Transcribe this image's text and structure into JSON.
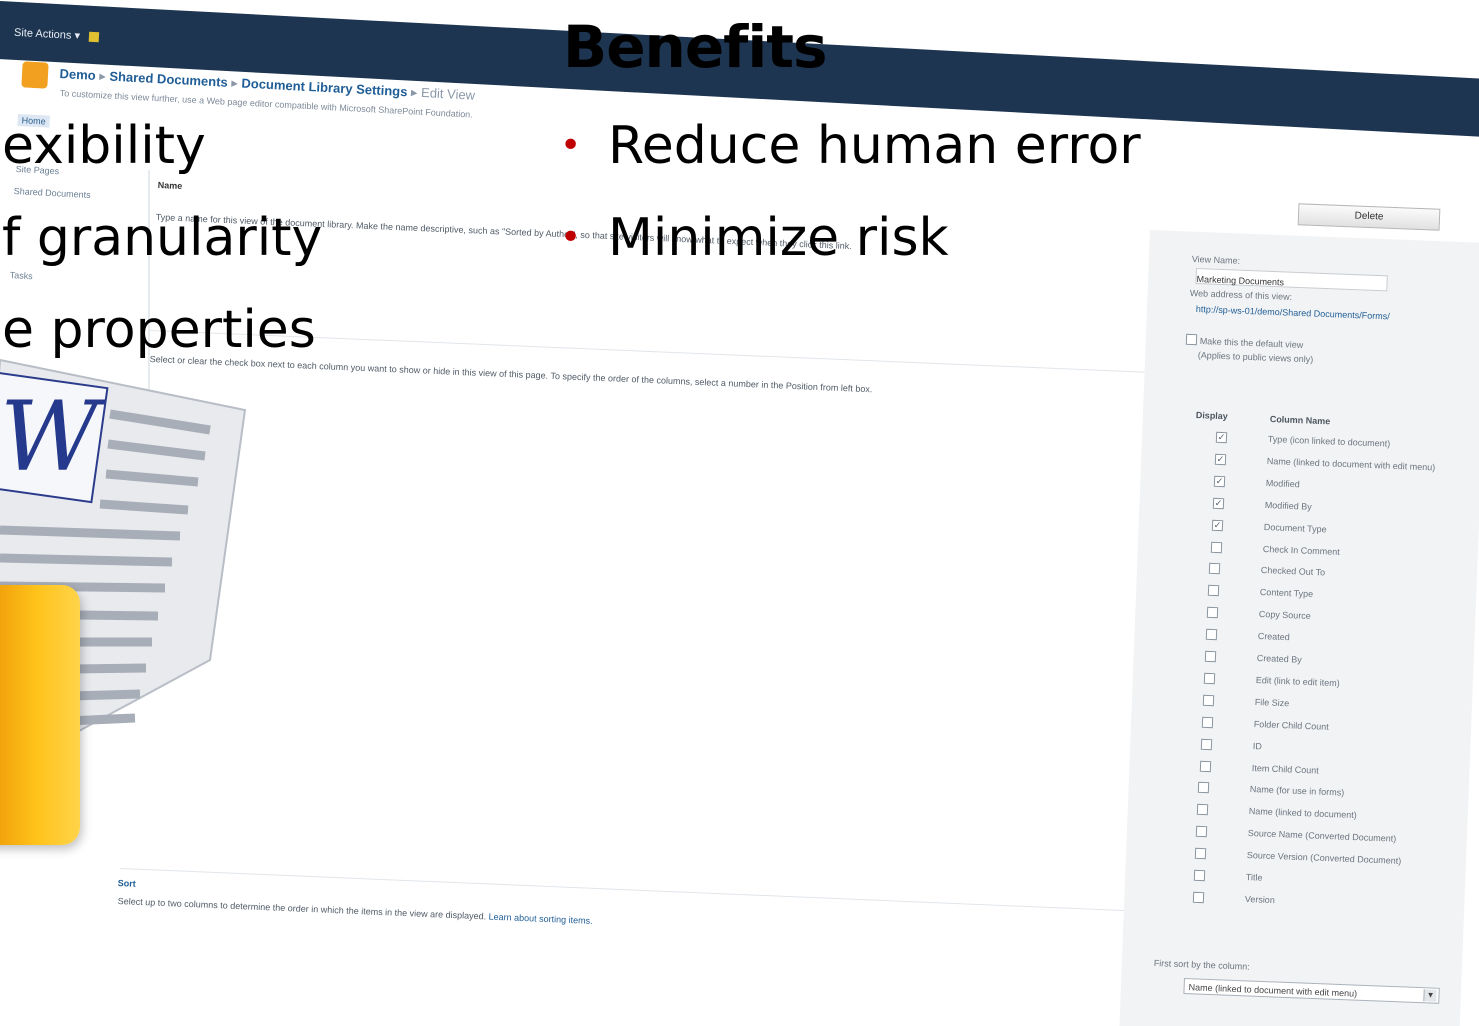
{
  "slide": {
    "title": "Benefits",
    "left_points": [
      "exibility",
      "f granularity",
      "e properties"
    ],
    "right_points": [
      "Reduce human error",
      "Minimize risk"
    ],
    "bullet_color": "#c00000"
  },
  "screenshot": {
    "site_actions": "Site Actions",
    "breadcrumb": {
      "site": "Demo",
      "library": "Shared Documents",
      "settings": "Document Library Settings",
      "page": "Edit View"
    },
    "subtitle": "To customize this view further, use a Web page editor compatible with Microsoft SharePoint Foundation.",
    "quick_launch": [
      "Home",
      "Site Pages",
      "Shared Documents",
      "Tasks"
    ],
    "name_section": {
      "heading": "Name",
      "help": "Type a name for this view of the document library. Make the name descriptive, such as \"Sorted by Author\", so that site visitors will know what to expect when they click this link."
    },
    "columns_help": "Select or clear the check box next to each column you want to show or hide in this view of this page. To specify the order of the columns, select a number in the Position from left box.",
    "sort_section": {
      "heading": "Sort",
      "help": "Select up to two columns to determine the order in which the items in the view are displayed.",
      "link": "Learn about sorting items."
    },
    "panel": {
      "delete_label": "Delete",
      "view_name_label": "View Name:",
      "view_name_value": "Marketing Documents",
      "web_address_label": "Web address of this view:",
      "web_address_value": "http://sp-ws-01/demo/Shared Documents/Forms/",
      "default_view_label": "Make this the default view",
      "default_view_note": "(Applies to public views only)",
      "display_header": "Display",
      "column_header": "Column Name",
      "columns": [
        {
          "name": "Type (icon linked to document)",
          "checked": true
        },
        {
          "name": "Name (linked to document with edit menu)",
          "checked": true
        },
        {
          "name": "Modified",
          "checked": true
        },
        {
          "name": "Modified By",
          "checked": true
        },
        {
          "name": "Document Type",
          "checked": true
        },
        {
          "name": "Check In Comment",
          "checked": false
        },
        {
          "name": "Checked Out To",
          "checked": false
        },
        {
          "name": "Content Type",
          "checked": false
        },
        {
          "name": "Copy Source",
          "checked": false
        },
        {
          "name": "Created",
          "checked": false
        },
        {
          "name": "Created By",
          "checked": false
        },
        {
          "name": "Edit (link to edit item)",
          "checked": false
        },
        {
          "name": "File Size",
          "checked": false
        },
        {
          "name": "Folder Child Count",
          "checked": false
        },
        {
          "name": "ID",
          "checked": false
        },
        {
          "name": "Item Child Count",
          "checked": false
        },
        {
          "name": "Name (for use in forms)",
          "checked": false
        },
        {
          "name": "Name (linked to document)",
          "checked": false
        },
        {
          "name": "Source Name (Converted Document)",
          "checked": false
        },
        {
          "name": "Source Version (Converted Document)",
          "checked": false
        },
        {
          "name": "Title",
          "checked": false
        },
        {
          "name": "Version",
          "checked": false
        }
      ],
      "sort_label": "First sort by the column:",
      "sort_value": "Name (linked to document with edit menu)"
    },
    "icon": {
      "word_letter": "W"
    }
  }
}
